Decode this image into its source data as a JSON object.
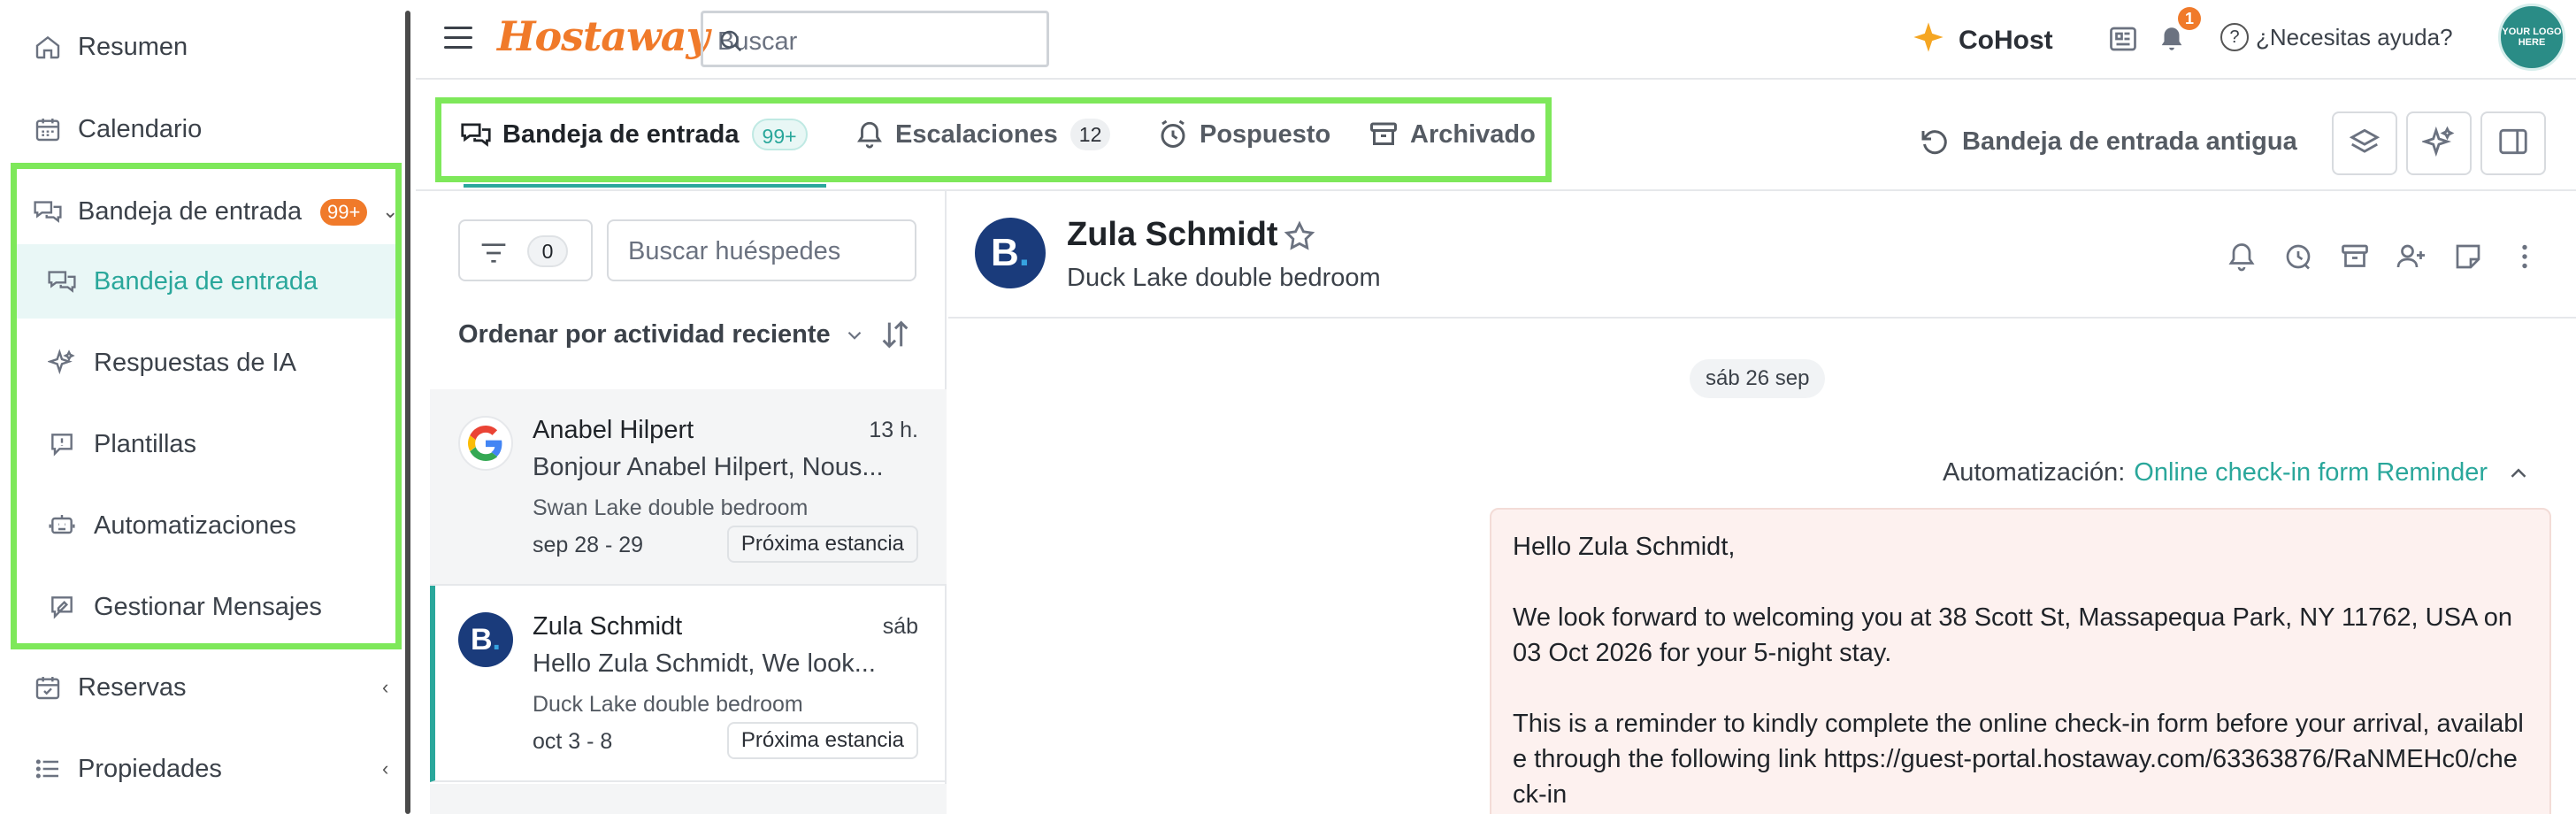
{
  "sidebar": {
    "items": [
      {
        "label": "Resumen"
      },
      {
        "label": "Calendario"
      },
      {
        "label": "Bandeja de entrada",
        "badge": "99+"
      },
      {
        "label": "Reservas"
      },
      {
        "label": "Propiedades"
      }
    ],
    "sub_items": [
      {
        "label": "Bandeja de entrada"
      },
      {
        "label": "Respuestas de IA"
      },
      {
        "label": "Plantillas"
      },
      {
        "label": "Automatizaciones"
      },
      {
        "label": "Gestionar Mensajes"
      }
    ]
  },
  "topbar": {
    "logo": "Hostaway",
    "search_placeholder": "Buscar",
    "cohost_label": "CoHost",
    "notification_count": "1",
    "help_label": "¿Necesitas ayuda?",
    "avatar_text": "YOUR LOGO HERE"
  },
  "tabs": [
    {
      "label": "Bandeja de entrada",
      "count": "99+"
    },
    {
      "label": "Escalaciones",
      "count": "12"
    },
    {
      "label": "Pospuesto"
    },
    {
      "label": "Archivado"
    }
  ],
  "old_inbox_label": "Bandeja de entrada antigua",
  "list": {
    "filter_count": "0",
    "search_placeholder": "Buscar huéspedes",
    "sort_label": "Ordenar por actividad reciente",
    "conversations": [
      {
        "name": "Anabel Hilpert",
        "time": "13 h.",
        "preview": "Bonjour Anabel Hilpert, Nous...",
        "property": "Swan Lake double bedroom",
        "dates": "sep 28 - 29",
        "status": "Próxima estancia",
        "channel": "google"
      },
      {
        "name": "Zula Schmidt",
        "time": "sáb",
        "preview": "Hello Zula Schmidt, We look...",
        "property": "Duck Lake double bedroom",
        "dates": "oct 3 - 8",
        "status": "Próxima estancia",
        "channel": "booking"
      }
    ]
  },
  "conversation": {
    "guest_name": "Zula Schmidt",
    "listing": "Duck Lake double bedroom",
    "channel_letter": "B",
    "date_chip": "sáb 26 sep",
    "automation_label": "Automatización:",
    "automation_name": "Online check-in form Reminder",
    "message": {
      "greeting": "Hello Zula Schmidt,",
      "p1": "We look forward to welcoming you at 38 Scott St, Massapequa Park, NY 11762, USA on 03 Oct 2026 for your 5-night stay.",
      "p2": "This is a reminder to kindly complete the online check-in form before your arrival, available through the following link https://guest-portal.hostaway.com/63363876/RaNMEHc0/check-in"
    }
  },
  "colors": {
    "accent": "#2aa79b",
    "brand": "#f07a2a",
    "highlight": "#7ee85a"
  }
}
